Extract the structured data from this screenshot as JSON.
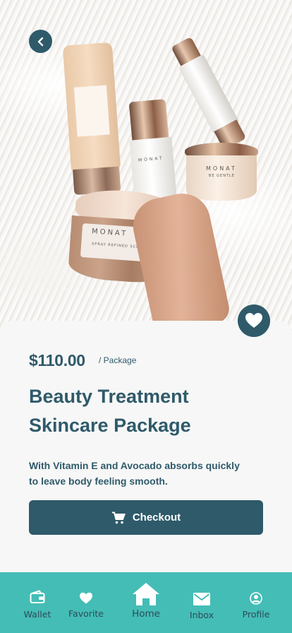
{
  "product": {
    "price": "$110.00",
    "unit": "/ Package",
    "title": "Beauty Treatment Skincare Package",
    "description": "With Vitamin E and Avocado absorbs quickly to leave body feeling smooth."
  },
  "hero": {
    "brand_text": "MONAT",
    "jar_label_text": "SPRAY REFINED SCRUB",
    "small_jar_label_text": "BE GENTLE"
  },
  "actions": {
    "checkout_label": "Checkout"
  },
  "nav": {
    "items": [
      {
        "label": "Wallet",
        "icon": "wallet-icon"
      },
      {
        "label": "Favorite",
        "icon": "heart-icon"
      },
      {
        "label": "Home",
        "icon": "home-icon"
      },
      {
        "label": "Inbox",
        "icon": "mail-icon"
      },
      {
        "label": "Profile",
        "icon": "user-icon"
      }
    ]
  },
  "colors": {
    "primary": "#2f5a6a",
    "nav_background": "#44bdb6",
    "card_background": "#f7f7f7"
  }
}
